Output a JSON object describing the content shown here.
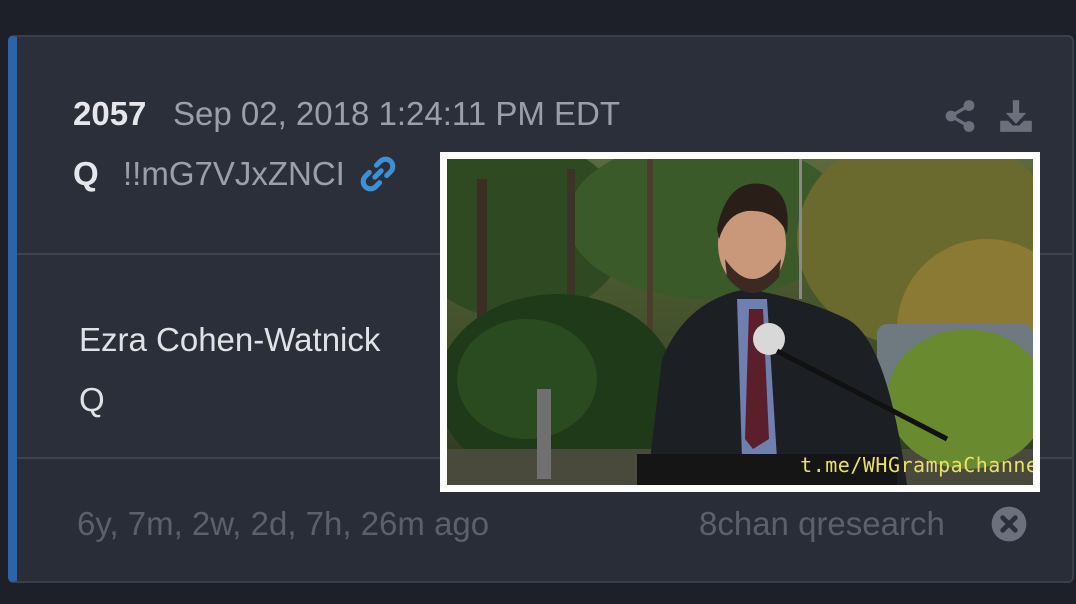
{
  "post": {
    "number": "2057",
    "date": "Sep 02, 2018 1:24:11 PM EDT",
    "author": "Q",
    "tripcode": "!!mG7VJxZNCI",
    "body": [
      "Ezra Cohen-Watnick",
      "Q"
    ],
    "time_ago": "6y, 7m, 2w, 2d, 7h, 26m ago",
    "source": "8chan qresearch"
  },
  "media": {
    "watermark": "t.me/WHGrampaChannel"
  },
  "icons": {
    "link": "link-icon",
    "share": "share-icon",
    "download": "download-icon",
    "close": "close-icon"
  },
  "colors": {
    "accent_bar": "#2f63a8",
    "link_icon": "#3d8fd6",
    "card_bg": "#2b2f3a",
    "watermark": "#e8e06a"
  }
}
